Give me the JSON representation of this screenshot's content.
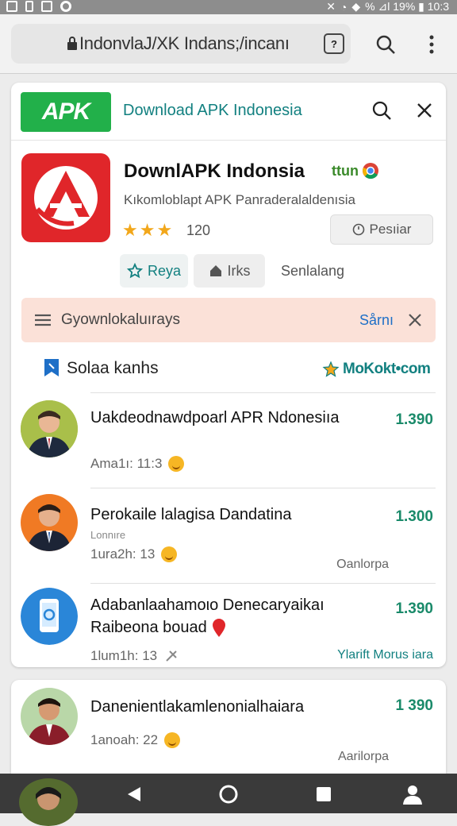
{
  "status_bar": {
    "right_text": "% ⊿l 19% ▮ 10:3"
  },
  "browser": {
    "url": "IndonvlaJ/XK Indans;/incanı"
  },
  "site": {
    "logo": "APK",
    "title": "Download APK Indonesia"
  },
  "app": {
    "name": "DownlAPK Indonsia",
    "tag": "ttun",
    "subtitle": "Kıkomloblapt APK Panraderalaldenısia",
    "stars": "★★★",
    "rating": "120",
    "preview_label": "Pesıiar"
  },
  "chips": [
    {
      "label": "Reya"
    },
    {
      "label": "Irks"
    },
    {
      "label": "Senlalang"
    }
  ],
  "banner": {
    "text": "Gyownlokaluırays",
    "action": "Sårnı"
  },
  "section": {
    "title": "Solaa kanhs",
    "link": "MoKokt•com"
  },
  "items": [
    {
      "title": "Uakdeodnawdpoarl APR Ndonesiıa",
      "meta": "Ama1ı: 11:3",
      "value": "1.390"
    },
    {
      "title": "Perokaile lalagisa Dandatina",
      "sub": "Lonnıre",
      "meta": "1ura2h: 13",
      "value": "1.300",
      "note": "Oanlorpa"
    },
    {
      "title": "Adabanlaahamoιo Denecaryaikaı Raibeona bouad",
      "meta": "1lum1h: 13",
      "value": "1.390",
      "note": "Ylarift Morus iara"
    },
    {
      "title": "Danenientlakamlenonialhaiara",
      "meta": "1anoah: 22",
      "value": "1 390",
      "note": "Aarilorpa"
    }
  ],
  "colors": {
    "accent_green": "#22b04a",
    "teal_text": "#128080",
    "app_red": "#e0262a",
    "banner_bg": "#fbe1d8",
    "value_green": "#1a8a6a"
  }
}
